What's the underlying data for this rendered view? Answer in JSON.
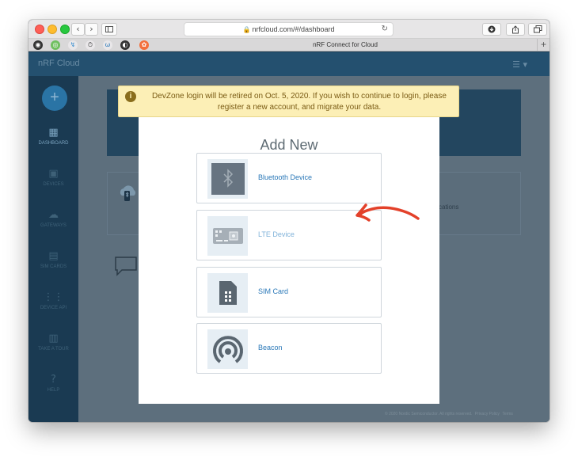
{
  "browser": {
    "url": "nrfcloud.com/#/dashboard",
    "tab_title": "nRF Connect for Cloud",
    "nav": {
      "back": "‹",
      "forward": "›"
    }
  },
  "app": {
    "brand": "nRF Cloud",
    "sidebar": {
      "add_label": "+",
      "items": [
        {
          "label": "DASHBOARD",
          "icon": "dashboard-icon",
          "glyph": "▦"
        },
        {
          "label": "DEVICES",
          "icon": "devices-icon",
          "glyph": "▣"
        },
        {
          "label": "GATEWAYS",
          "icon": "gateways-icon",
          "glyph": "☁"
        },
        {
          "label": "SIM CARDS",
          "icon": "sim-icon",
          "glyph": "▤"
        },
        {
          "label": "DEVICE API",
          "icon": "api-icon",
          "glyph": "⋮⋮"
        },
        {
          "label": "TAKE A TOUR",
          "icon": "map-icon",
          "glyph": "▥"
        },
        {
          "label": "HELP",
          "icon": "help-icon",
          "glyph": "?"
        }
      ]
    },
    "card_text": "cations",
    "footer": {
      "copyright": "© 2020 Nordic Semiconductor. All rights reserved.",
      "privacy": "Privacy Policy",
      "terms": "Terms"
    }
  },
  "banner": {
    "message": "DevZone login will be retired on Oct. 5, 2020. If you wish to continue to login, please register a new account, and migrate your data."
  },
  "modal": {
    "title": "Add New",
    "options": [
      {
        "label": "Bluetooth Device",
        "icon": "bluetooth-icon"
      },
      {
        "label": "LTE Device",
        "icon": "lte-board-icon"
      },
      {
        "label": "SIM Card",
        "icon": "sim-card-icon"
      },
      {
        "label": "Beacon",
        "icon": "beacon-icon"
      }
    ]
  },
  "colors": {
    "accent": "#2a78b8",
    "annotation": "#e3412a",
    "banner_bg": "#fcefb6"
  }
}
